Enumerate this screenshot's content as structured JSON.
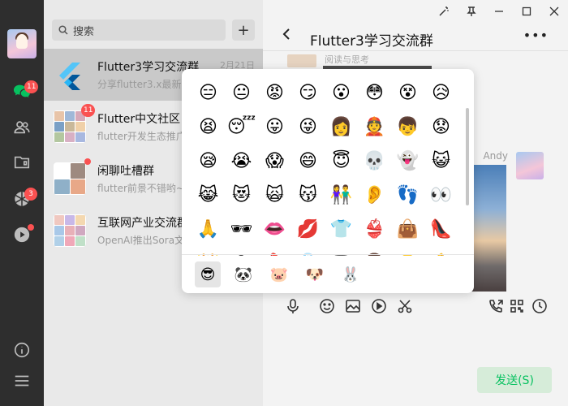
{
  "sidebar": {
    "chat_badge": "11",
    "moments_badge": "3",
    "icons": [
      "chat-icon",
      "contacts-icon",
      "folder-icon",
      "moments-icon",
      "video-channel-icon",
      "info-icon",
      "menu-icon"
    ]
  },
  "search": {
    "placeholder": "搜索"
  },
  "chats": [
    {
      "title": "Flutter3学习交流群",
      "subtitle": "分享flutter3.x最新",
      "date": "2月21日"
    },
    {
      "title": "Flutter中文社区",
      "subtitle": "flutter开发生态推广",
      "badge": "11"
    },
    {
      "title": "闲聊吐槽群",
      "subtitle": "flutter前景不错哟~"
    },
    {
      "title": "互联网产业交流群",
      "subtitle": "OpenAI推出Sora文"
    }
  ],
  "window": {
    "title": "Flutter3学习交流群",
    "top_message_text": "阅读与思考",
    "andy_name": "Andy",
    "send_label": "发送(S)"
  },
  "emoji": {
    "rows": [
      [
        "😑",
        "😐",
        "😡",
        "😏",
        "😮",
        "😳",
        "😵",
        "😥"
      ],
      [
        "😫",
        "😴",
        "😛",
        "😜",
        "👩",
        "👲",
        "👦",
        "😟"
      ],
      [
        "😪",
        "😭",
        "😱",
        "😄",
        "😇",
        "💀",
        "👻",
        "😺"
      ],
      [
        "😹",
        "😻",
        "🙀",
        "😽",
        "👫",
        "👂",
        "👣",
        "👀"
      ],
      [
        "🙏",
        "🕶",
        "👄",
        "💋",
        "👕",
        "👙",
        "👜",
        "👠"
      ],
      [
        "👑",
        "🎓",
        "💄",
        "💍",
        "🎩",
        "👨",
        "👴",
        "💪"
      ]
    ],
    "tabs": [
      "😎",
      "🐼",
      "🐷",
      "🐶",
      "🐰"
    ]
  }
}
